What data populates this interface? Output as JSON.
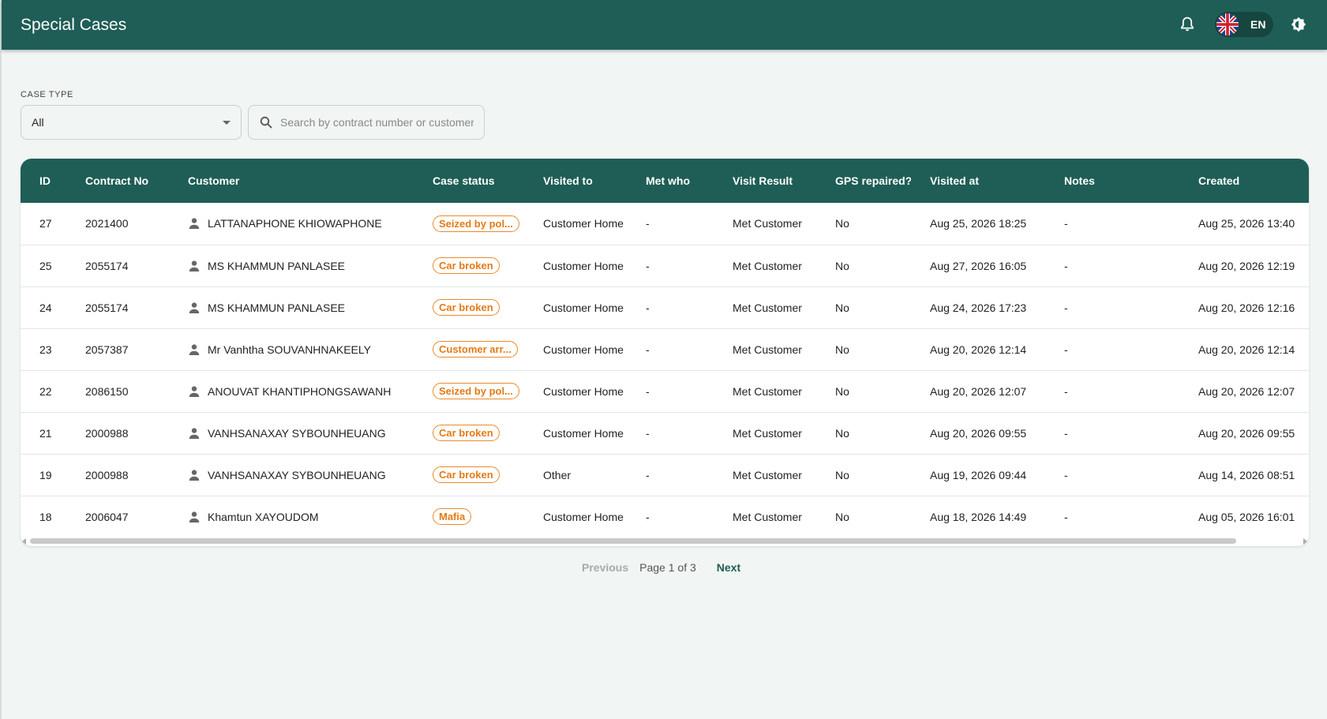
{
  "header": {
    "title": "Special Cases",
    "language_code": "EN",
    "icons": [
      "bell-icon",
      "uk-flag-icon",
      "theme-toggle-icon"
    ]
  },
  "filters": {
    "case_type_label": "CASE TYPE",
    "case_type_value": "All",
    "search_placeholder": "Search by contract number or customer"
  },
  "table": {
    "columns": [
      "ID",
      "Contract No",
      "Customer",
      "Case status",
      "Visited to",
      "Met who",
      "Visit Result",
      "GPS repaired?",
      "Visited at",
      "Notes",
      "Created"
    ],
    "rows": [
      {
        "id": "27",
        "contract": "2021400",
        "customer": "LATTANAPHONE KHIOWAPHONE",
        "status": "Seized by pol...",
        "visited_to": "Customer Home",
        "met_who": "-",
        "result": "Met Customer",
        "gps": "No",
        "visited_at": "Aug 25, 2026 18:25",
        "notes": "-",
        "created": "Aug 25, 2026 13:40"
      },
      {
        "id": "25",
        "contract": "2055174",
        "customer": "MS KHAMMUN PANLASEE",
        "status": "Car broken",
        "visited_to": "Customer Home",
        "met_who": "-",
        "result": "Met Customer",
        "gps": "No",
        "visited_at": "Aug 27, 2026 16:05",
        "notes": "-",
        "created": "Aug 20, 2026 12:19"
      },
      {
        "id": "24",
        "contract": "2055174",
        "customer": "MS KHAMMUN PANLASEE",
        "status": "Car broken",
        "visited_to": "Customer Home",
        "met_who": "-",
        "result": "Met Customer",
        "gps": "No",
        "visited_at": "Aug 24, 2026 17:23",
        "notes": "-",
        "created": "Aug 20, 2026 12:16"
      },
      {
        "id": "23",
        "contract": "2057387",
        "customer": "Mr Vanhtha SOUVANHNAKEELY",
        "status": "Customer arr...",
        "visited_to": "Customer Home",
        "met_who": "-",
        "result": "Met Customer",
        "gps": "No",
        "visited_at": "Aug 20, 2026 12:14",
        "notes": "-",
        "created": "Aug 20, 2026 12:14"
      },
      {
        "id": "22",
        "contract": "2086150",
        "customer": "ANOUVAT KHANTIPHONGSAWANH",
        "status": "Seized by pol...",
        "visited_to": "Customer Home",
        "met_who": "-",
        "result": "Met Customer",
        "gps": "No",
        "visited_at": "Aug 20, 2026 12:07",
        "notes": "-",
        "created": "Aug 20, 2026 12:07"
      },
      {
        "id": "21",
        "contract": "2000988",
        "customer": "VANHSANAXAY SYBOUNHEUANG",
        "status": "Car broken",
        "visited_to": "Customer Home",
        "met_who": "-",
        "result": "Met Customer",
        "gps": "No",
        "visited_at": "Aug 20, 2026 09:55",
        "notes": "-",
        "created": "Aug 20, 2026 09:55"
      },
      {
        "id": "19",
        "contract": "2000988",
        "customer": "VANHSANAXAY SYBOUNHEUANG",
        "status": "Car broken",
        "visited_to": "Other",
        "met_who": "-",
        "result": "Met Customer",
        "gps": "No",
        "visited_at": "Aug 19, 2026 09:44",
        "notes": "-",
        "created": "Aug 14, 2026 08:51"
      },
      {
        "id": "18",
        "contract": "2006047",
        "customer": "Khamtun XAYOUDOM",
        "status": "Mafia",
        "visited_to": "Customer Home",
        "met_who": "-",
        "result": "Met Customer",
        "gps": "No",
        "visited_at": "Aug 18, 2026 14:49",
        "notes": "-",
        "created": "Aug 05, 2026 16:01"
      }
    ]
  },
  "pagination": {
    "previous_label": "Previous",
    "page_label": "Page 1 of 3",
    "next_label": "Next"
  },
  "colors": {
    "primary": "#1e5e56",
    "status_chip": "#e37a14",
    "background": "#f1f5f3"
  }
}
